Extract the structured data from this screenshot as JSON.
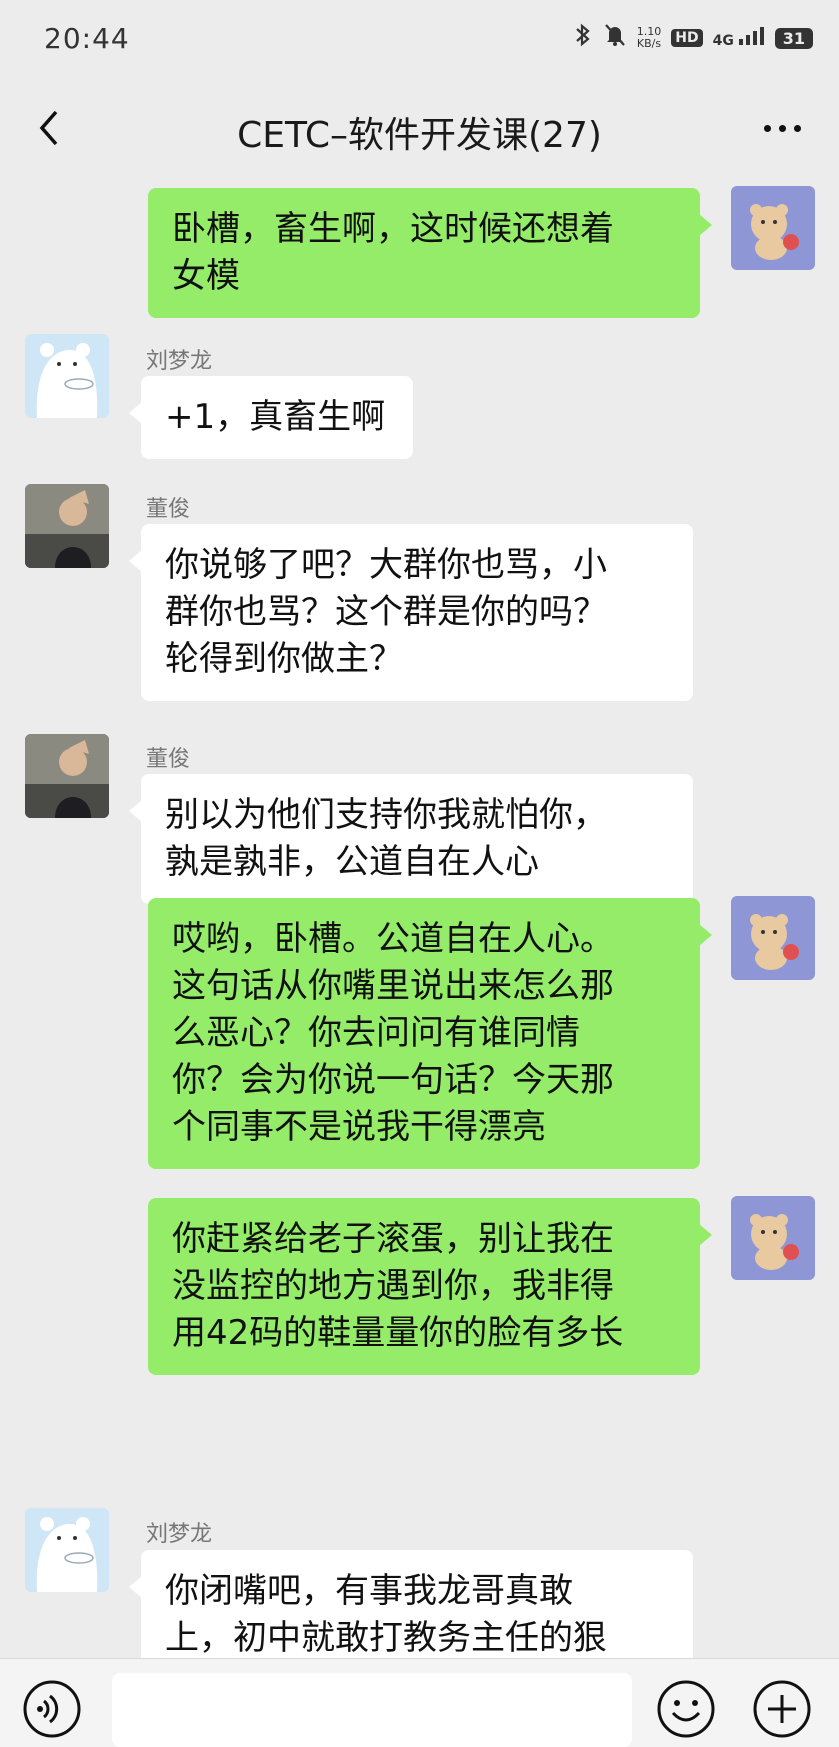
{
  "status_bar": {
    "time": "20:44",
    "net_speed_value": "1.10",
    "net_speed_unit": "KB/s",
    "hd_label": "HD",
    "network_label": "4G",
    "battery": "31"
  },
  "header": {
    "title": "CETC–软件开发课(27)"
  },
  "messages": [
    {
      "sender": "",
      "text": "卧槽，畜生啊，这时候还想着\n女模"
    },
    {
      "sender": "刘梦龙",
      "text": "+1，真畜生啊"
    },
    {
      "sender": "董俊",
      "text": "你说够了吧？大群你也骂，小\n群你也骂？这个群是你的吗？\n轮得到你做主？"
    },
    {
      "sender": "董俊",
      "text": "别以为他们支持你我就怕你，\n孰是孰非，公道自在人心"
    },
    {
      "sender": "",
      "text": "哎哟，卧槽。公道自在人心。\n这句话从你嘴里说出来怎么那\n么恶心？你去问问有谁同情\n你？会为你说一句话？今天那\n个同事不是说我干得漂亮"
    },
    {
      "sender": "",
      "text": "你赶紧给老子滚蛋，别让我在\n没监控的地方遇到你，我非得\n用42码的鞋量量你的脸有多长"
    },
    {
      "sender": "刘梦龙",
      "text": "你闭嘴吧，有事我龙哥真敢\n上，初中就敢打教务主任的狠"
    }
  ]
}
